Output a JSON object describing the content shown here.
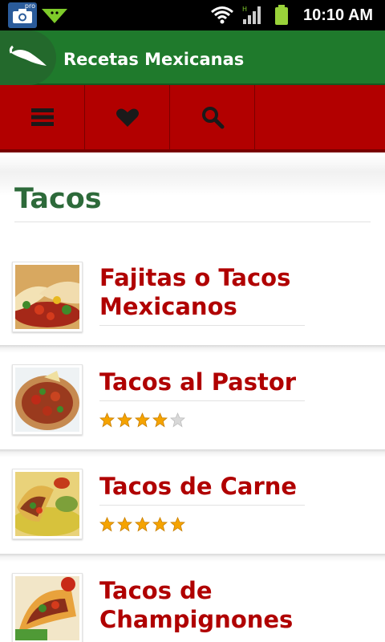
{
  "status_bar": {
    "time": "10:10 AM",
    "pro_badge": "pro",
    "icons": [
      "camera-pro-icon",
      "android-debug-icon",
      "wifi-icon",
      "signal-icon",
      "battery-icon"
    ]
  },
  "app_bar": {
    "title": "Recetas Mexicanas",
    "logo_icon": "chili-pepper-icon",
    "color": "#1f7a2c"
  },
  "toolbar": {
    "color": "#b20000",
    "buttons": [
      {
        "icon": "menu-icon"
      },
      {
        "icon": "heart-icon"
      },
      {
        "icon": "search-icon"
      }
    ]
  },
  "section": {
    "title": "Tacos"
  },
  "recipes": [
    {
      "name_line1": "Fajitas o Tacos",
      "name_line2": "Mexicanos",
      "rating": null
    },
    {
      "name_line1": "Tacos al Pastor",
      "name_line2": "",
      "rating": 4
    },
    {
      "name_line1": "Tacos de Carne",
      "name_line2": "",
      "rating": 5
    },
    {
      "name_line1": "Tacos de",
      "name_line2": "Champignones",
      "rating": null
    }
  ],
  "colors": {
    "recipe_title": "#b00000",
    "section_title": "#2d6a3a",
    "star_filled": "#f5a300",
    "star_empty": "#d8d8d8"
  }
}
